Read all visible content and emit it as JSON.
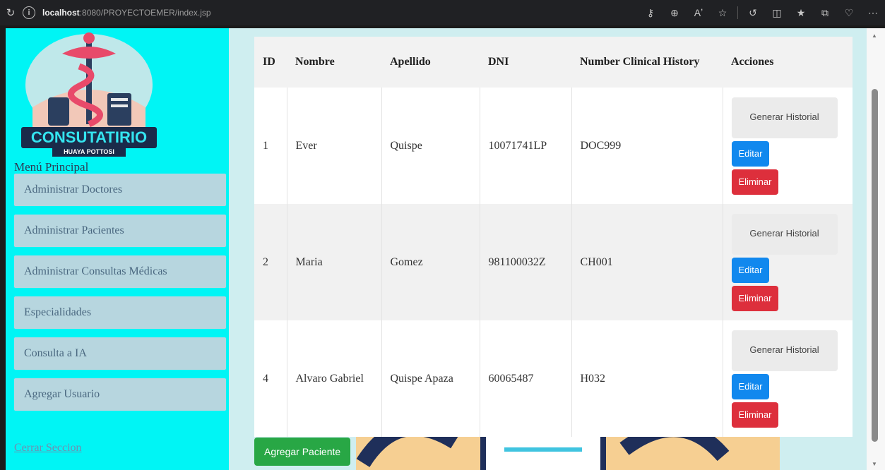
{
  "browser": {
    "url_host": "localhost",
    "url_path": ":8080/PROYECTOEMER/index.jsp"
  },
  "sidebar": {
    "logo_text": "CONSUTATIRIO",
    "logo_subtext": "HUAYA POTTOSI",
    "menu_title": "Menú Principal",
    "items": [
      {
        "label": "Administrar Doctores"
      },
      {
        "label": "Administrar Pacientes"
      },
      {
        "label": "Administrar Consultas Médicas"
      },
      {
        "label": "Especialidades"
      },
      {
        "label": "Consulta a IA"
      },
      {
        "label": "Agregar Usuario"
      }
    ],
    "logout": "Cerrar Seccion"
  },
  "table": {
    "headers": {
      "id": "ID",
      "nombre": "Nombre",
      "apellido": "Apellido",
      "dni": "DNI",
      "history": "Number Clinical History",
      "acciones": "Acciones"
    },
    "rows": [
      {
        "id": "1",
        "nombre": "Ever",
        "apellido": "Quispe",
        "dni": "10071741LP",
        "history": "DOC999"
      },
      {
        "id": "2",
        "nombre": "Maria",
        "apellido": "Gomez",
        "dni": "981100032Z",
        "history": "CH001"
      },
      {
        "id": "4",
        "nombre": "Alvaro Gabriel",
        "apellido": "Quispe Apaza",
        "dni": "60065487",
        "history": "H032"
      }
    ],
    "actions": {
      "generate": "Generar Historial",
      "edit": "Editar",
      "delete": "Eliminar"
    }
  },
  "add_button": "Agregar Paciente",
  "colors": {
    "sidebar_bg": "#00f5f5",
    "nav_item_bg": "#b7d6df",
    "edit": "#1188ee",
    "delete": "#dd2f3c",
    "add": "#28a745"
  }
}
